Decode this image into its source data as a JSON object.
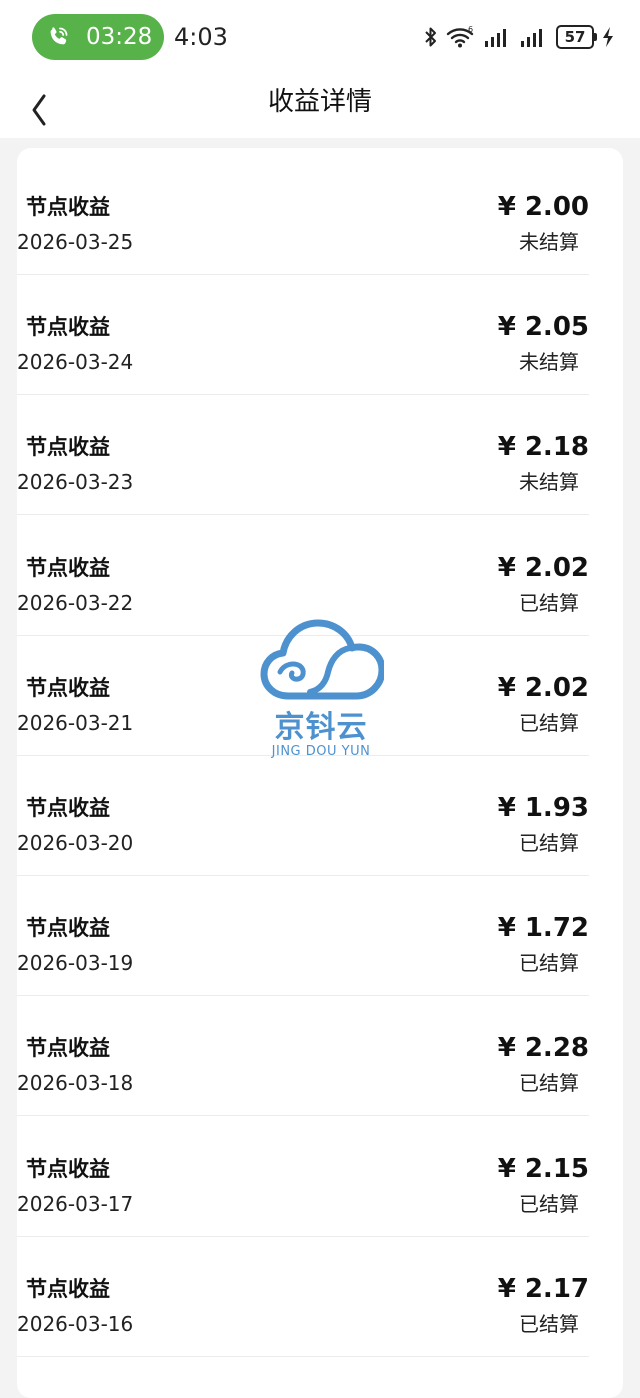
{
  "status_bar": {
    "call_time": "03:28",
    "clock": "4:03",
    "battery": "57",
    "icons": [
      "bluetooth-icon",
      "wifi-icon",
      "signal-icon",
      "signal-icon",
      "battery-icon",
      "charging-icon"
    ]
  },
  "header": {
    "title": "收益详情",
    "back_icon": "chevron-left-icon"
  },
  "records": [
    {
      "title": "节点收益",
      "date": "2026-03-25",
      "amount": "¥ 2.00",
      "status": "未结算"
    },
    {
      "title": "节点收益",
      "date": "2026-03-24",
      "amount": "¥ 2.05",
      "status": "未结算"
    },
    {
      "title": "节点收益",
      "date": "2026-03-23",
      "amount": "¥ 2.18",
      "status": "未结算"
    },
    {
      "title": "节点收益",
      "date": "2026-03-22",
      "amount": "¥ 2.02",
      "status": "已结算"
    },
    {
      "title": "节点收益",
      "date": "2026-03-21",
      "amount": "¥ 2.02",
      "status": "已结算"
    },
    {
      "title": "节点收益",
      "date": "2026-03-20",
      "amount": "¥ 1.93",
      "status": "已结算"
    },
    {
      "title": "节点收益",
      "date": "2026-03-19",
      "amount": "¥ 1.72",
      "status": "已结算"
    },
    {
      "title": "节点收益",
      "date": "2026-03-18",
      "amount": "¥ 2.28",
      "status": "已结算"
    },
    {
      "title": "节点收益",
      "date": "2026-03-17",
      "amount": "¥ 2.15",
      "status": "已结算"
    },
    {
      "title": "节点收益",
      "date": "2026-03-16",
      "amount": "¥ 2.17",
      "status": "已结算"
    }
  ],
  "watermark": {
    "text_cn": "京钭云",
    "text_en": "JING DOU YUN"
  },
  "colors": {
    "call_pill": "#58b24a",
    "watermark": "#2f7fc6",
    "background": "#f3f3f3"
  }
}
